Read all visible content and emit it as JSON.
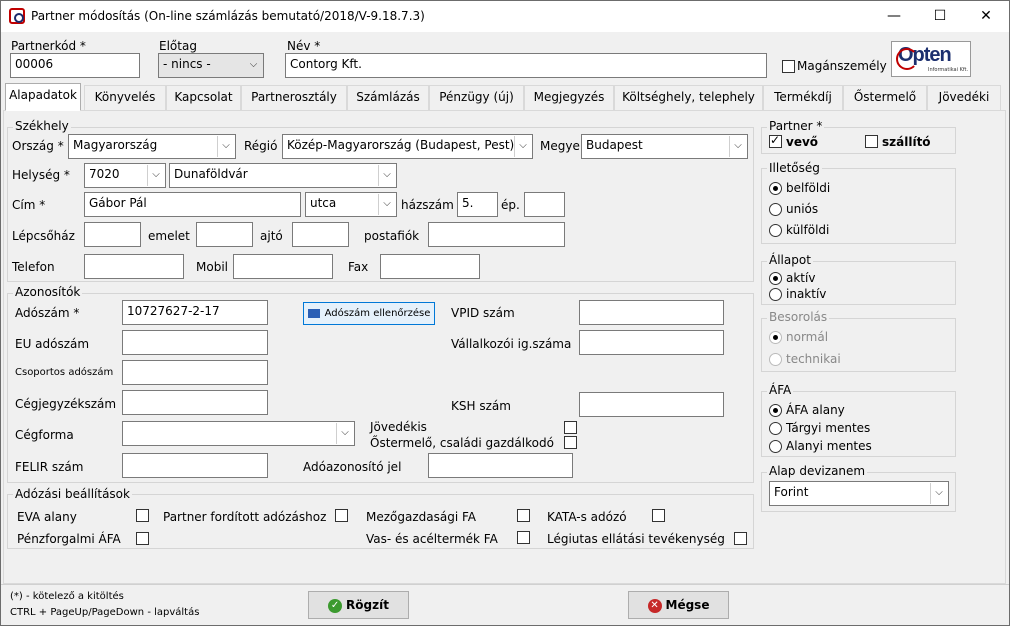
{
  "window": {
    "title": "Partner módosítás (On-line számlázás bemutató/2018/V-9.18.7.3)",
    "minimize": "—",
    "maximize": "☐",
    "close": "✕"
  },
  "header": {
    "partnerkod_label": "Partnerkód *",
    "partnerkod_value": "00006",
    "elotag_label": "Előtag",
    "elotag_value": "- nincs -",
    "nev_label": "Név *",
    "nev_value": "Contorg Kft.",
    "maganszemely_label": "Magánszemély",
    "logo_text": "Opten",
    "logo_sub": "Informatikai Kft."
  },
  "tabs": [
    "Alapadatok",
    "Könyvelés",
    "Kapcsolat",
    "Partnerosztály",
    "Számlázás",
    "Pénzügy (új)",
    "Megjegyzés",
    "Költséghely, telephely",
    "Termékdíj",
    "Őstermelő",
    "Jövedéki"
  ],
  "szekhely": {
    "title": "Székhely",
    "orszag_label": "Ország *",
    "orszag_value": "Magyarország",
    "regio_label": "Régió",
    "regio_value": "Közép-Magyarország (Budapest, Pest)",
    "megye_label": "Megye",
    "megye_value": "Budapest",
    "helyseg_label": "Helység *",
    "irsz_value": "7020",
    "helyseg_value": "Dunaföldvár",
    "cim_label": "Cím *",
    "cim_value": "Gábor Pál",
    "kozterulet_value": "utca",
    "hazszam_label": "házszám",
    "hazszam_value": "5.",
    "ep_label": "ép.",
    "lepcsohaz_label": "Lépcsőház",
    "emelet_label": "emelet",
    "ajto_label": "ajtó",
    "postafiok_label": "postafiók",
    "telefon_label": "Telefon",
    "mobil_label": "Mobil",
    "fax_label": "Fax"
  },
  "azonositok": {
    "title": "Azonosítók",
    "adoszam_label": "Adószám *",
    "adoszam_value": "10727627-2-17",
    "adoszam_ell_button": "Adószám ellenőrzése",
    "vpid_label": "VPID szám",
    "eu_label": "EU adószám",
    "vallalkozoi_label": "Vállalkozói ig.száma",
    "csoportos_label": "Csoportos adószám",
    "cegjegyzek_label": "Cégjegyzékszám",
    "ksh_label": "KSH szám",
    "cegforma_label": "Cégforma",
    "jovedekis_label": "Jövedékis",
    "ostermelo_label": "Őstermelő, családi gazdálkodó",
    "felir_label": "FELIR szám",
    "adoazonosito_label": "Adóazonosító jel"
  },
  "adozasi": {
    "title": "Adózási beállítások",
    "eva": "EVA alany",
    "forditott": "Partner fordított adózáshoz",
    "mezogazdasagi": "Mezőgazdasági FA",
    "kata": "KATA-s adózó",
    "penzforgalmi": "Pénzforgalmi ÁFA",
    "vasacel": "Vas- és acéltermék FA",
    "legiutas": "Légiutas ellátási tevékenység"
  },
  "partner": {
    "title": "Partner *",
    "vevo": "vevő",
    "szallito": "szállító",
    "vevo_checked": true,
    "szallito_checked": false
  },
  "illetoseg": {
    "title": "Illetőség",
    "options": [
      "belföldi",
      "uniós",
      "külföldi"
    ],
    "selected": "belföldi"
  },
  "allapot": {
    "title": "Állapot",
    "options": [
      "aktív",
      "inaktív"
    ],
    "selected": "aktív"
  },
  "besorolas": {
    "title": "Besorolás",
    "options": [
      "normál",
      "technikai"
    ],
    "selected": "normál"
  },
  "afa": {
    "title": "ÁFA",
    "options": [
      "ÁFA alany",
      "Tárgyi mentes",
      "Alanyi mentes"
    ],
    "selected": "ÁFA alany"
  },
  "deviza": {
    "title": "Alap devizanem",
    "value": "Forint"
  },
  "footer": {
    "note1": "(*) - kötelező a kitöltés",
    "note2": "CTRL + PageUp/PageDown - lapváltás",
    "rogzit": "Rögzít",
    "megse": "Mégse"
  }
}
